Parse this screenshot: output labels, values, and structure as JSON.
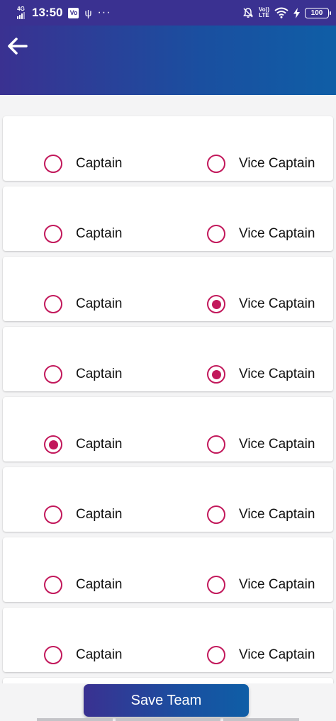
{
  "status_bar": {
    "network": "4G",
    "time": "13:50",
    "notification_badge": "Vo",
    "volte": [
      "Vo))",
      "LTE"
    ],
    "battery": "100"
  },
  "app_bar": {
    "back_icon": "arrow-left-icon"
  },
  "players": [
    {
      "captain_label": "Captain",
      "vice_label": "Vice Captain",
      "captain_selected": false,
      "vice_selected": false
    },
    {
      "captain_label": "Captain",
      "vice_label": "Vice Captain",
      "captain_selected": false,
      "vice_selected": false
    },
    {
      "captain_label": "Captain",
      "vice_label": "Vice Captain",
      "captain_selected": false,
      "vice_selected": true
    },
    {
      "captain_label": "Captain",
      "vice_label": "Vice Captain",
      "captain_selected": false,
      "vice_selected": true
    },
    {
      "captain_label": "Captain",
      "vice_label": "Vice Captain",
      "captain_selected": true,
      "vice_selected": false
    },
    {
      "captain_label": "Captain",
      "vice_label": "Vice Captain",
      "captain_selected": false,
      "vice_selected": false
    },
    {
      "captain_label": "Captain",
      "vice_label": "Vice Captain",
      "captain_selected": false,
      "vice_selected": false
    },
    {
      "captain_label": "Captain",
      "vice_label": "Vice Captain",
      "captain_selected": false,
      "vice_selected": false
    }
  ],
  "save_button": {
    "label": "Save Team"
  },
  "colors": {
    "header_start": "#3a3191",
    "header_end": "#0f5ea6",
    "radio_accent": "#c2185b"
  }
}
